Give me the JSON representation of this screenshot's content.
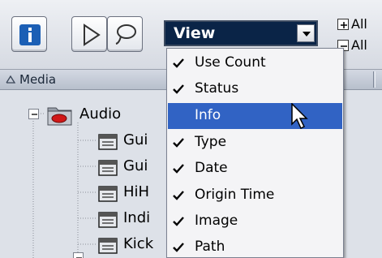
{
  "toolbar": {
    "view_select": {
      "value": "View"
    },
    "side_options": [
      {
        "symbol": "plus",
        "label": "All"
      },
      {
        "symbol": "minus",
        "label": "All"
      }
    ]
  },
  "header": {
    "column_label": "Media"
  },
  "tree": {
    "root": {
      "label": "Audio",
      "icon": "audio-folder-icon"
    },
    "children": [
      {
        "label": "Gui",
        "icon": "audio-file-icon"
      },
      {
        "label": "Gui",
        "icon": "audio-file-icon"
      },
      {
        "label": "HiH",
        "icon": "audio-file-icon"
      },
      {
        "label": "Indi",
        "icon": "audio-file-icon"
      },
      {
        "label": "Kick",
        "icon": "audio-file-icon"
      }
    ]
  },
  "menu": {
    "items": [
      {
        "label": "Use Count",
        "checked": true,
        "highlighted": false
      },
      {
        "label": "Status",
        "checked": true,
        "highlighted": false
      },
      {
        "label": "Info",
        "checked": false,
        "highlighted": true
      },
      {
        "label": "Type",
        "checked": true,
        "highlighted": false
      },
      {
        "label": "Date",
        "checked": true,
        "highlighted": false
      },
      {
        "label": "Origin Time",
        "checked": true,
        "highlighted": false
      },
      {
        "label": "Image",
        "checked": true,
        "highlighted": false
      },
      {
        "label": "Path",
        "checked": true,
        "highlighted": false
      }
    ]
  },
  "colors": {
    "highlight": "#3163c4",
    "view_select_bg": "#0a2447",
    "info_icon": "#1b5fb5",
    "folder_red": "#d01818"
  }
}
